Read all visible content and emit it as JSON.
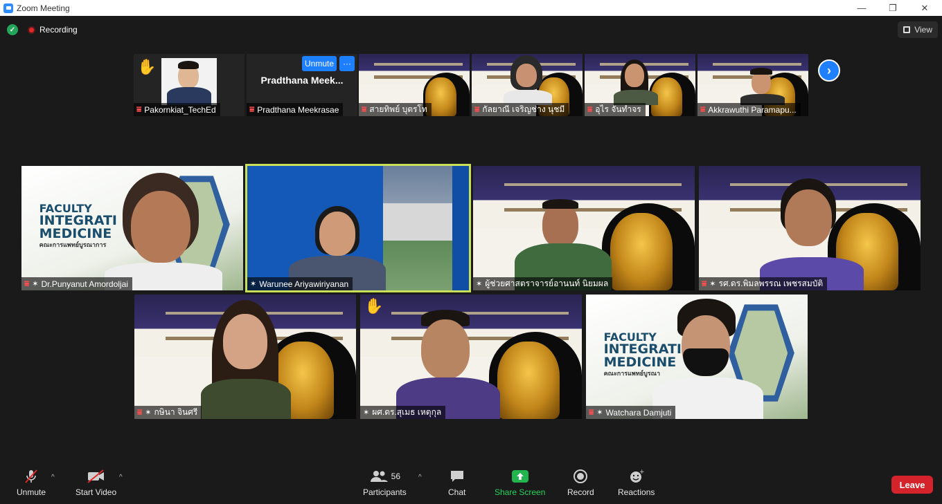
{
  "window": {
    "title": "Zoom Meeting"
  },
  "topbar": {
    "recording_label": "Recording",
    "view_label": "View"
  },
  "strip": {
    "tiles": [
      {
        "name": "Pakornkiat_TechEd"
      },
      {
        "name": "Pradthana Meekrasae",
        "display_name": "Pradthana  Meek...",
        "unmute_label": "Unmute",
        "more_label": "···"
      },
      {
        "name": "สายทิพย์  บุตรโท"
      },
      {
        "name": "กัลยาณี เจริญช่าง นุชมี"
      },
      {
        "name": "อุไร จันทำจร"
      },
      {
        "name": "Akkrawuthi Paramapu..."
      }
    ]
  },
  "gallery": {
    "tiles": [
      {
        "name": "Dr.Punyanut Amordoljai",
        "fac1": "FACULTY",
        "fac2": "INTEGRATI",
        "fac3": "MEDICINE",
        "fac4": "คณะการแพทย์บูรณาการ"
      },
      {
        "name": "Warunee Ariyawiriyanan"
      },
      {
        "name": "ผู้ช่วยศาสตราจารย์อานนท์ นิยมผล"
      },
      {
        "name": "รศ.ดร.พิมลพรรณ เพชรสมบัติ"
      },
      {
        "name": "กษินา  จินศรี"
      },
      {
        "name": "ผศ.ดร.สุเมธ เหตุกุล"
      },
      {
        "name": "Watchara Damjuti",
        "fac1": "FACULTY",
        "fac2": "INTEGRATI",
        "fac3": "MEDICINE",
        "fac4": "คณะการแพทย์บูรณา"
      }
    ]
  },
  "toolbar": {
    "unmute_label": "Unmute",
    "video_label": "Start Video",
    "participants_label": "Participants",
    "participants_count": "56",
    "chat_label": "Chat",
    "share_label": "Share Screen",
    "record_label": "Record",
    "reactions_label": "Reactions",
    "leave_label": "Leave"
  },
  "colors": {
    "accent": "#1e7fff",
    "leave": "#d4232b",
    "share": "#23b54d",
    "active_speaker": "#c8e05a"
  }
}
